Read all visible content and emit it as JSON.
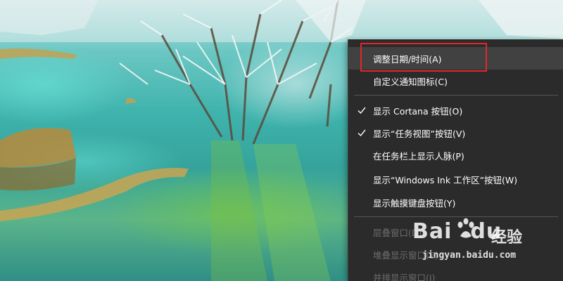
{
  "desktop": {
    "wallpaper": "snowy trees over turquoise terraced pools"
  },
  "context_menu": {
    "items": [
      {
        "label": "调整日期/时间(A)",
        "checked": false,
        "disabled": false,
        "highlighted": true
      },
      {
        "label": "自定义通知图标(C)",
        "checked": false,
        "disabled": false
      },
      {
        "label": "显示 Cortana 按钮(O)",
        "checked": true,
        "disabled": false
      },
      {
        "label": "显示“任务视图”按钮(V)",
        "checked": true,
        "disabled": false
      },
      {
        "label": "在任务栏上显示人脉(P)",
        "checked": false,
        "disabled": false
      },
      {
        "label": "显示“Windows Ink 工作区”按钮(W)",
        "checked": false,
        "disabled": false
      },
      {
        "label": "显示触摸键盘按钮(Y)",
        "checked": false,
        "disabled": false
      },
      {
        "label": "层叠窗口(D)",
        "checked": false,
        "disabled": true
      },
      {
        "label": "堆叠显示窗口(E)",
        "checked": false,
        "disabled": true
      },
      {
        "label": "并排显示窗口(I)",
        "checked": false,
        "disabled": true
      }
    ],
    "colors": {
      "background": "#2b2b2b",
      "hover": "#414141",
      "text": "#ffffff",
      "disabled_text": "#6d6d6d",
      "annotation_border": "#e0262b"
    }
  },
  "watermark": {
    "brand": "Bai",
    "brand_suffix": "du",
    "product": "经验",
    "url": "jingyan.baidu.com"
  }
}
